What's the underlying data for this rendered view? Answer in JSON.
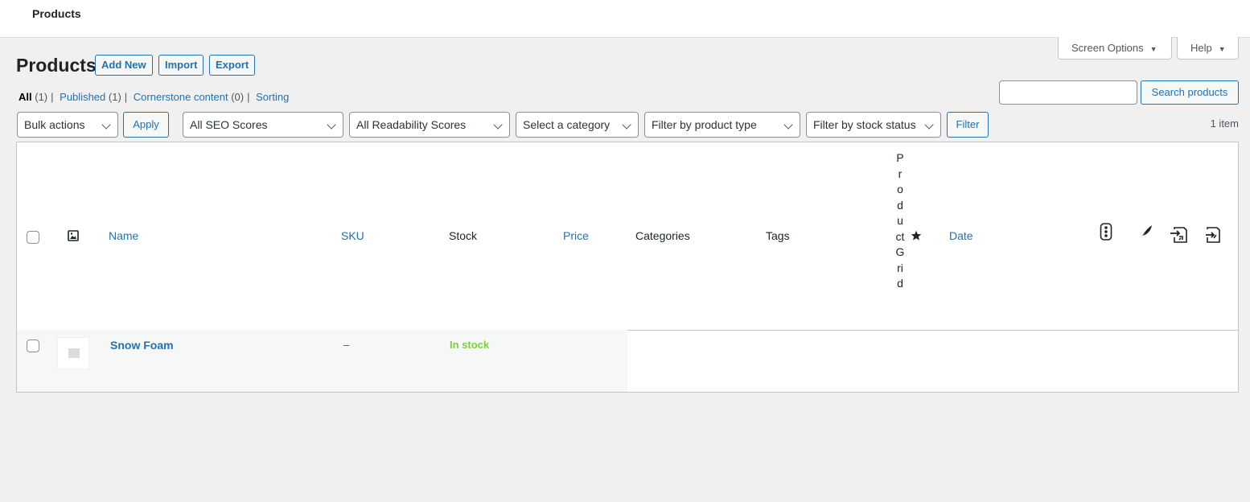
{
  "topbar": {
    "title": "Products"
  },
  "screen_meta": {
    "screen_options": "Screen Options",
    "help": "Help"
  },
  "header": {
    "title": "Products",
    "add_new": "Add New",
    "import": "Import",
    "export": "Export"
  },
  "views": [
    {
      "label": "All",
      "count": "(1)"
    },
    {
      "label": "Published",
      "count": "(1)"
    },
    {
      "label": "Cornerstone content",
      "count": "(0)"
    },
    {
      "label": "Sorting"
    }
  ],
  "search": {
    "value": "",
    "button": "Search products"
  },
  "filters": {
    "bulk_actions": "Bulk actions",
    "apply": "Apply",
    "seo_scores": "All SEO Scores",
    "readability": "All Readability Scores",
    "category": "Select a category",
    "product_type": "Filter by product type",
    "stock_status": "Filter by stock status",
    "filter": "Filter"
  },
  "item_count": "1 item",
  "columns": {
    "name": "Name",
    "sku": "SKU",
    "stock": "Stock",
    "price": "Price",
    "categories": "Categories",
    "tags": "Tags",
    "product_grid": "ProductGrid",
    "date": "Date"
  },
  "icons": {
    "thumbnail_col": "image-icon",
    "featured_col": "star-icon",
    "seo_col": "traffic-light-icon",
    "readability_col": "feather-icon",
    "outgoing_links_col": "outgoing-link-icon",
    "incoming_links_col": "incoming-link-icon"
  },
  "rows": [
    {
      "name": "Snow Foam",
      "sku": "–",
      "stock": "In stock",
      "price": "",
      "categories": "",
      "tags": "",
      "date": ""
    }
  ],
  "colors": {
    "link": "#2271b1",
    "in_stock": "#7ad03a",
    "background": "#f0f0f1"
  }
}
